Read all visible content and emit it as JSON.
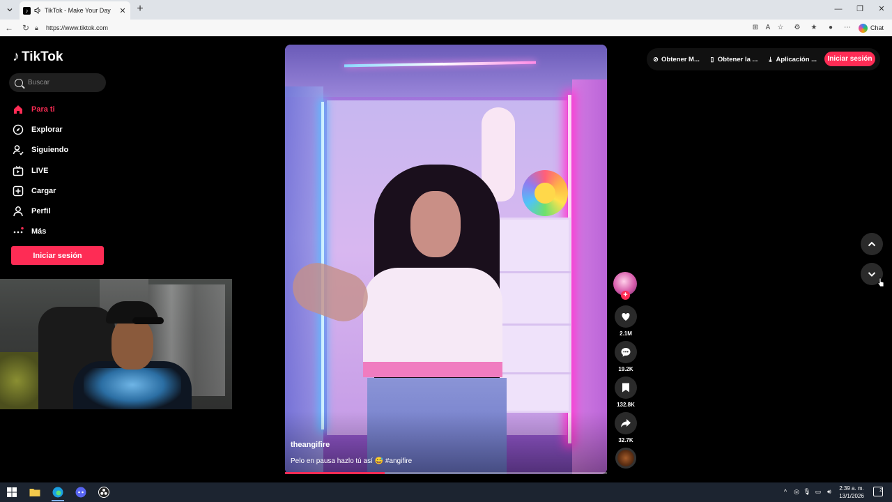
{
  "browser": {
    "tab_title": "TikTok - Make Your Day",
    "new_tab": "+",
    "url": "https://www.tiktok.com",
    "chat_label": "Chat",
    "window_controls": {
      "minimize": "—",
      "restore": "❐",
      "close": "✕"
    }
  },
  "sidebar": {
    "logo_text": "TikTok",
    "search_placeholder": "Buscar",
    "items": [
      {
        "label": "Para ti",
        "icon": "home-icon",
        "active": true
      },
      {
        "label": "Explorar",
        "icon": "compass-icon"
      },
      {
        "label": "Siguiendo",
        "icon": "following-icon"
      },
      {
        "label": "LIVE",
        "icon": "live-icon"
      },
      {
        "label": "Cargar",
        "icon": "upload-icon"
      },
      {
        "label": "Perfil",
        "icon": "profile-icon"
      },
      {
        "label": "Más",
        "icon": "more-icon"
      }
    ],
    "login_label": "Iniciar sesión"
  },
  "video": {
    "username": "theangifire",
    "caption": "Pelo en pausa hazlo tú así 😅 #angifire",
    "progress": 0.31
  },
  "actions": {
    "likes": "2.1M",
    "comments": "19.2K",
    "saves": "132.8K",
    "shares": "32.7K"
  },
  "topbar": {
    "items": [
      {
        "label": "Obtener M...",
        "icon": "coin-icon"
      },
      {
        "label": "Obtener la ...",
        "icon": "phone-icon"
      },
      {
        "label": "Aplicación ...",
        "icon": "download-icon"
      }
    ],
    "login_label": "Iniciar sesión"
  },
  "taskbar": {
    "time": "2:39 a. m.",
    "date": "13/1/2026",
    "notifications": "2"
  },
  "colors": {
    "accent": "#fe2c55",
    "background": "#000000"
  }
}
